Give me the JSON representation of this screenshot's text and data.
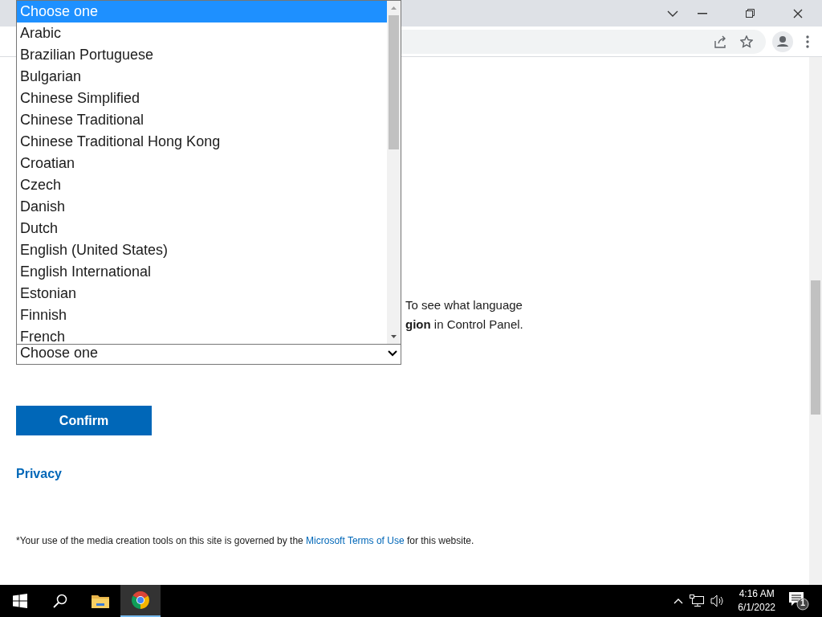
{
  "language_dropdown": {
    "options": [
      {
        "label": "Choose one",
        "selected": true
      },
      {
        "label": "Arabic",
        "selected": false
      },
      {
        "label": "Brazilian Portuguese",
        "selected": false
      },
      {
        "label": "Bulgarian",
        "selected": false
      },
      {
        "label": "Chinese Simplified",
        "selected": false
      },
      {
        "label": "Chinese Traditional",
        "selected": false
      },
      {
        "label": "Chinese Traditional Hong Kong",
        "selected": false
      },
      {
        "label": "Croatian",
        "selected": false
      },
      {
        "label": "Czech",
        "selected": false
      },
      {
        "label": "Danish",
        "selected": false
      },
      {
        "label": "Dutch",
        "selected": false
      },
      {
        "label": "English (United States)",
        "selected": false
      },
      {
        "label": "English International",
        "selected": false
      },
      {
        "label": "Estonian",
        "selected": false
      },
      {
        "label": "Finnish",
        "selected": false
      },
      {
        "label": "French",
        "selected": false
      }
    ]
  },
  "language_select": {
    "value": "Choose one"
  },
  "instructions": [
    "To see what language",
    "**gion** in Control Panel."
  ],
  "confirm_button": "Confirm",
  "privacy_link": "Privacy",
  "footer": {
    "before": "*Your use of the media creation tools on this site is governed by the ",
    "link": "Microsoft Terms of Use",
    "after": " for this website."
  },
  "taskbar": {
    "time": "4:16 AM",
    "date": "6/1/2022",
    "notification_count": "1"
  }
}
